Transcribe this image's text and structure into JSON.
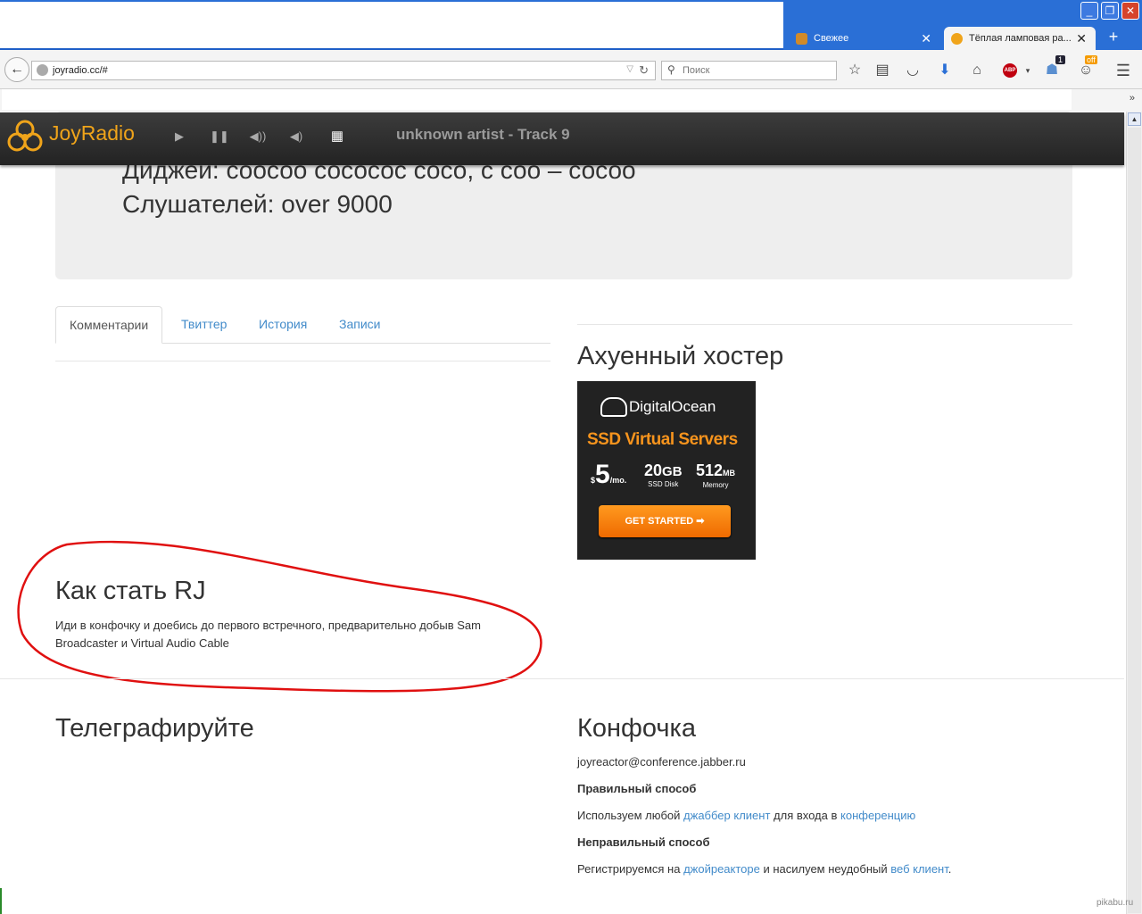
{
  "browser": {
    "tabs": [
      {
        "title": "Свежее",
        "active": false
      },
      {
        "title": "Тёплая ламповая ра...",
        "active": true
      }
    ],
    "new_tab": "+",
    "url": "joyradio.cc/#",
    "search_placeholder": "Поиск",
    "badges": {
      "notifications": "1",
      "off": "off"
    },
    "abp_label": "ABP",
    "more": "»"
  },
  "player": {
    "logo_text": "JoyRadio",
    "now_playing": "unknown artist - Track 9"
  },
  "jumbotron": {
    "hidden_line": "Диджей: соосоо сососос сосо, с соо – сосоо",
    "listeners": "Слушателей: over 9000"
  },
  "content_tabs": [
    {
      "label": "Комментарии",
      "active": true
    },
    {
      "label": "Твиттер",
      "active": false
    },
    {
      "label": "История",
      "active": false
    },
    {
      "label": "Записи",
      "active": false
    }
  ],
  "hoster": {
    "title": "Ахуенный хостер",
    "ad": {
      "brand": "DigitalOcean",
      "headline": "SSD Virtual Servers",
      "price": "5",
      "price_currency": "$",
      "price_unit": "/mo.",
      "disk": "20",
      "disk_unit": "GB",
      "disk_label": "SSD Disk",
      "memory": "512",
      "memory_unit": "MB",
      "memory_label": "Memory",
      "cta": "GET STARTED ➡"
    }
  },
  "rj": {
    "title": "Как стать RJ",
    "text": "Иди в конфочку и доебись до первого встречного, предварительно добыв Sam Broadcaster и Virtual Audio Cable"
  },
  "telegraph": {
    "title": "Телеграфируйте"
  },
  "konfochka": {
    "title": "Конфочка",
    "jid": "joyreactor@conference.jabber.ru",
    "right_way": "Правильный способ",
    "right_text_1": "Используем любой ",
    "right_link_1": "джаббер клиент",
    "right_text_2": " для входа в ",
    "right_link_2": "конференцию",
    "wrong_way": "Неправильный способ",
    "wrong_text_1": "Регистрируемся на ",
    "wrong_link_1": "джойреакторе",
    "wrong_text_2": " и насилуем неудобный ",
    "wrong_link_2": "веб клиент",
    "wrong_text_3": "."
  },
  "watermark": "pikabu.ru",
  "colors": {
    "accent": "#428bca",
    "logo": "#f0a41a",
    "annotation": "#e01010"
  }
}
